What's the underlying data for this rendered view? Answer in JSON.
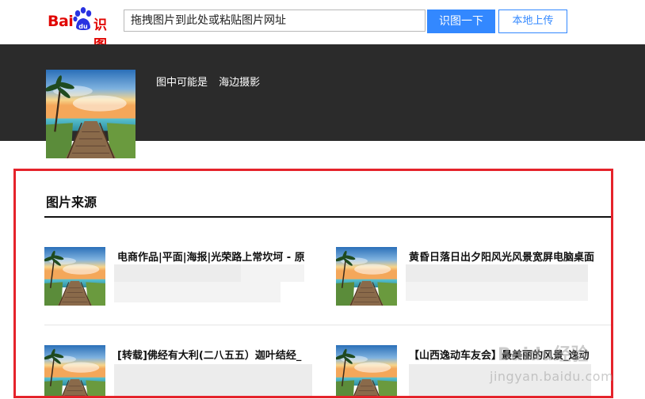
{
  "logo": {
    "text_bai": "Bai",
    "text_du": "du",
    "text_shitu": "识图"
  },
  "search": {
    "placeholder": "拖拽图片到此处或粘贴图片网址",
    "submit_label": "识图一下",
    "upload_label": "本地上传"
  },
  "guess": {
    "label": "图中可能是",
    "value": "海边摄影"
  },
  "sources": {
    "title": "图片来源",
    "items": [
      {
        "title": "电商作品|平面|海报|光荣路上常坎坷 - 原"
      },
      {
        "title": "黄昏日落日出夕阳风光风景宽屏电脑桌面"
      },
      {
        "title": "[转载]佛经有大利(二八五五）迦叶结经_"
      },
      {
        "title": "【山西逸动车友会】最美丽的风景_逸动"
      }
    ]
  },
  "watermark": {
    "main": "Baidu经验",
    "url": "jingyan.baidu.com"
  },
  "colors": {
    "brand_red": "#e10602",
    "brand_blue": "#2932e1",
    "button_blue": "#3388ff",
    "banner": "#2b2b2b",
    "highlight_border": "#e5232b"
  }
}
